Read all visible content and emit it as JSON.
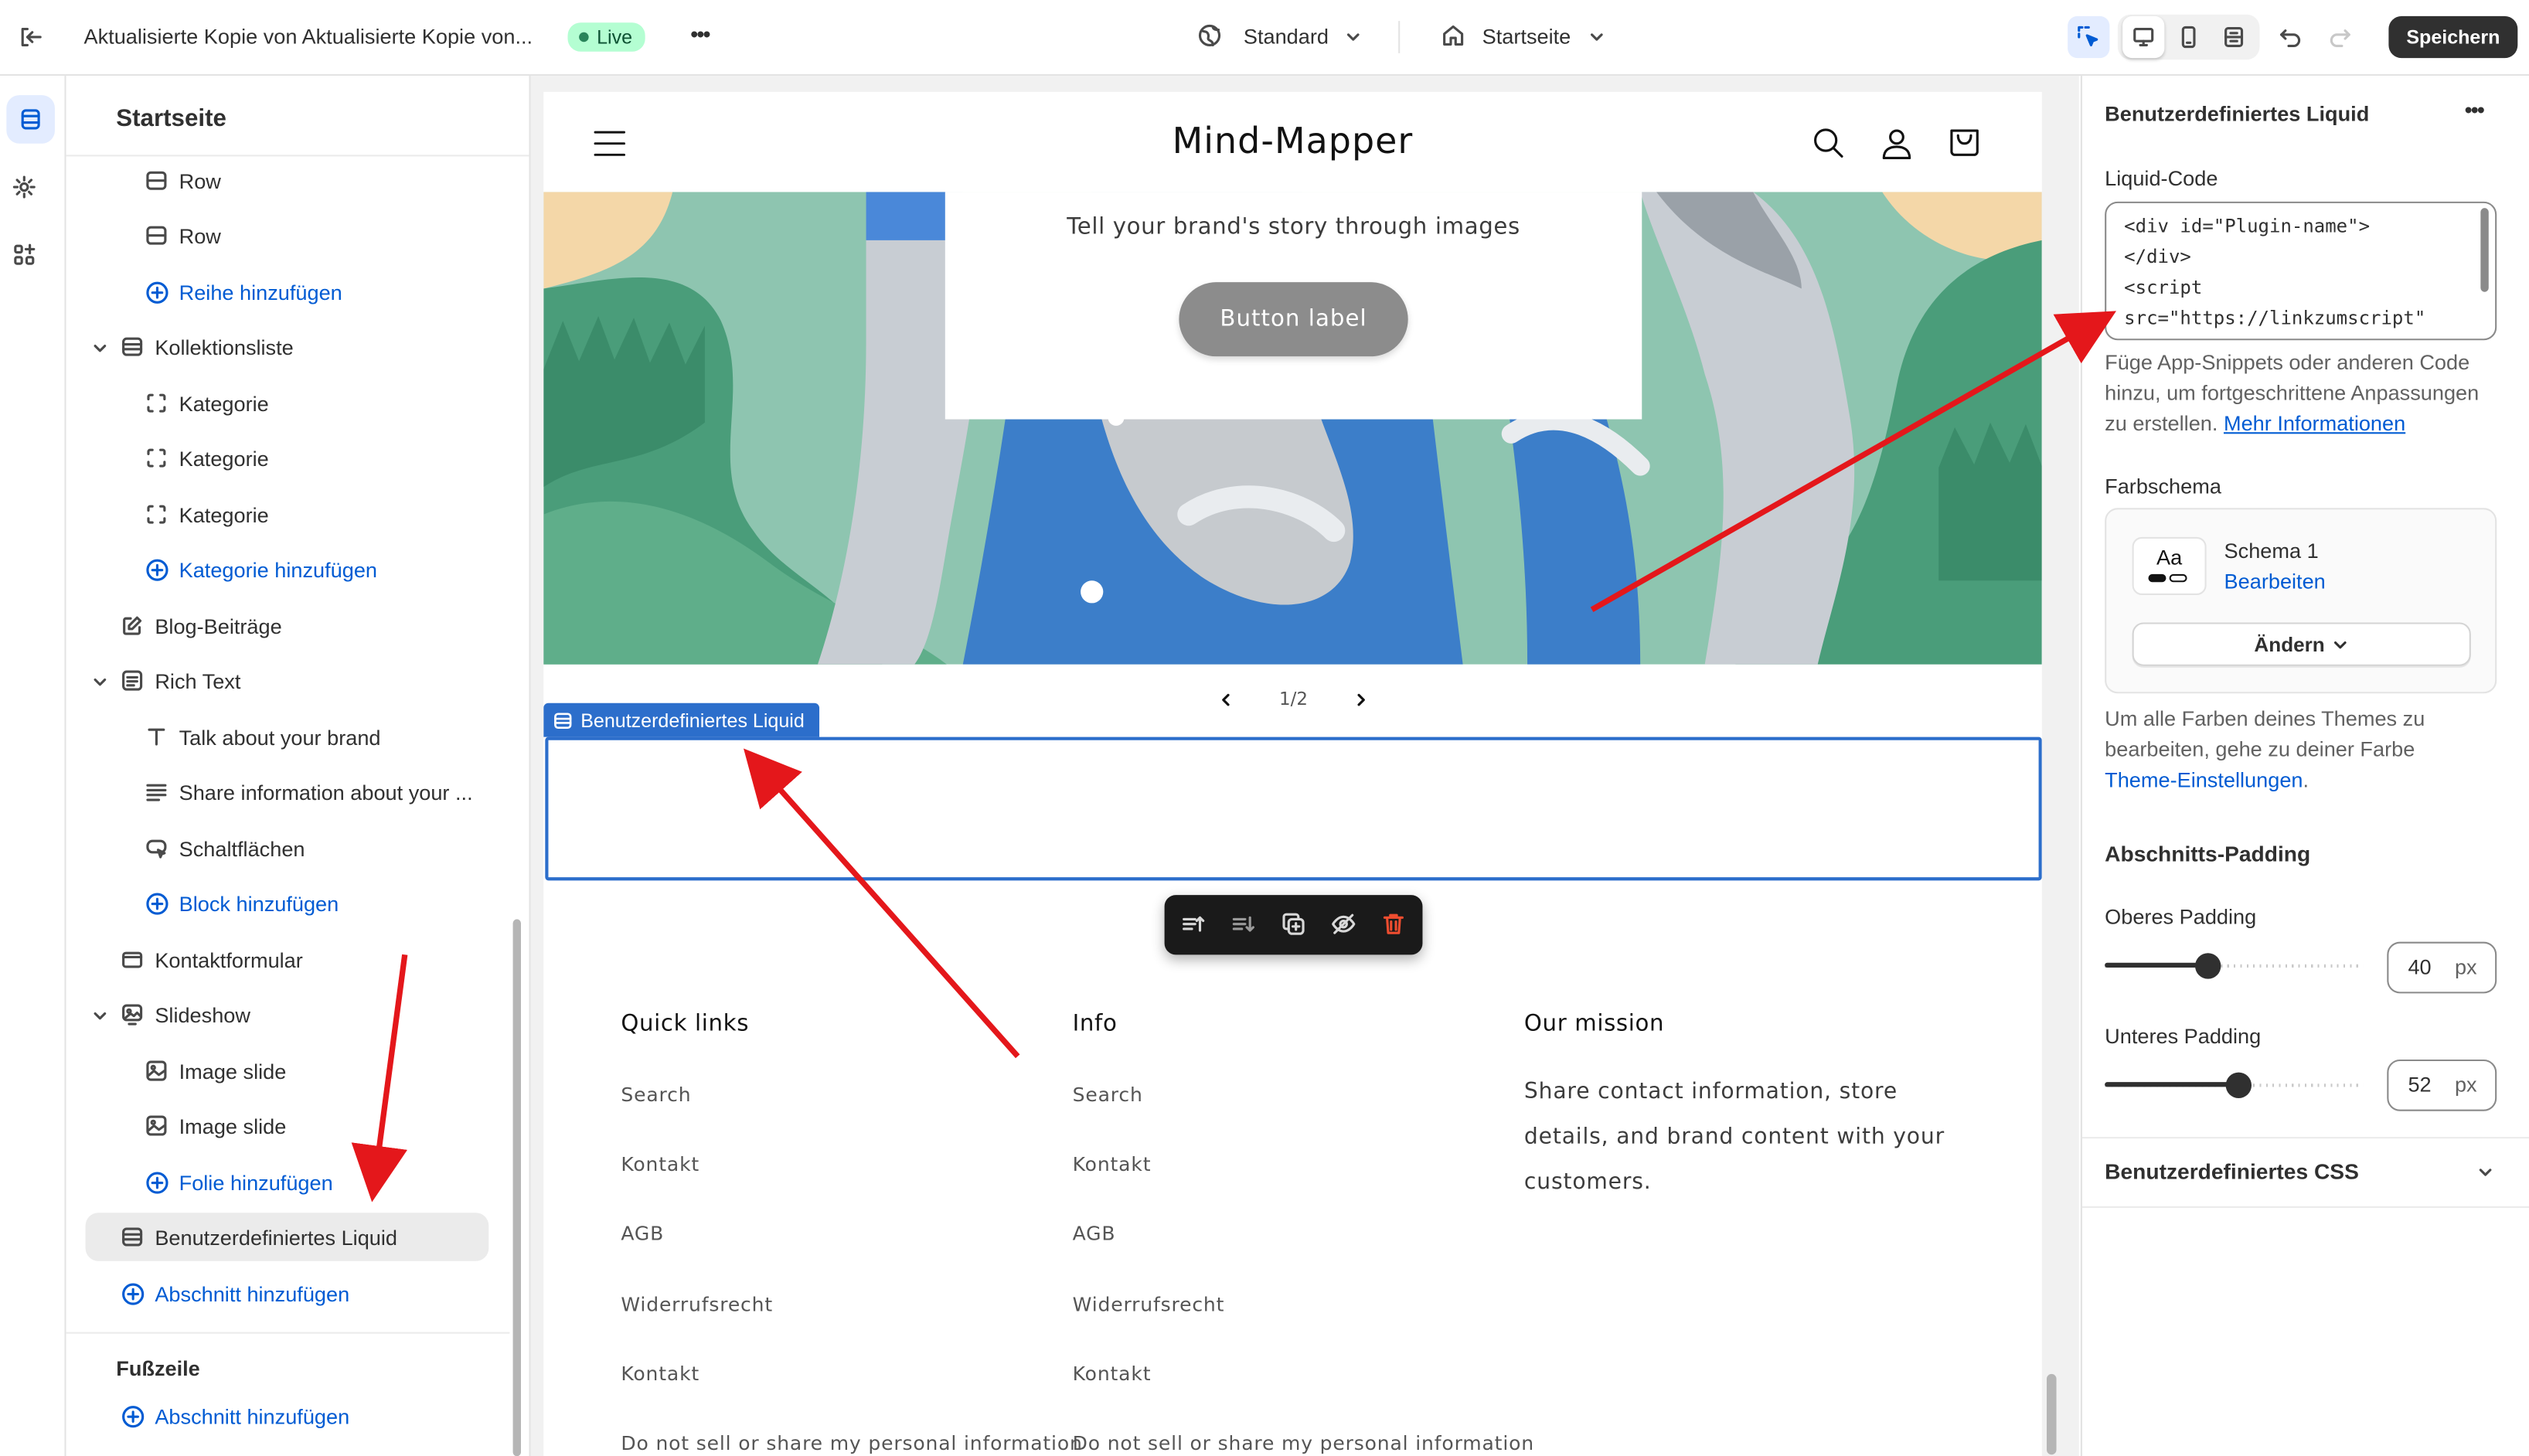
{
  "topbar": {
    "title": "Aktualisierte Kopie von Aktualisierte Kopie von...",
    "live_badge": "Live",
    "more": "•••",
    "theme_select": "Standard",
    "page_select": "Startseite",
    "save_label": "Speichern"
  },
  "sidebar": {
    "title": "Startseite",
    "items": [
      {
        "label": "Row"
      },
      {
        "label": "Row"
      },
      {
        "label": "Reihe hinzufügen"
      },
      {
        "label": "Kollektionsliste"
      },
      {
        "label": "Kategorie"
      },
      {
        "label": "Kategorie"
      },
      {
        "label": "Kategorie"
      },
      {
        "label": "Kategorie hinzufügen"
      },
      {
        "label": "Blog-Beiträge"
      },
      {
        "label": "Rich Text"
      },
      {
        "label": "Talk about your brand"
      },
      {
        "label": "Share information about your ..."
      },
      {
        "label": "Schaltflächen"
      },
      {
        "label": "Block hinzufügen"
      },
      {
        "label": "Kontaktformular"
      },
      {
        "label": "Slideshow"
      },
      {
        "label": "Image slide"
      },
      {
        "label": "Image slide"
      },
      {
        "label": "Folie hinzufügen"
      },
      {
        "label": "Benutzerdefiniertes Liquid"
      },
      {
        "label": "Abschnitt hinzufügen"
      }
    ],
    "footer_title": "Fußzeile",
    "footer_add": "Abschnitt hinzufügen"
  },
  "preview": {
    "store_name": "Mind-Mapper",
    "slide_text": "Tell your brand's story through images",
    "slide_button": "Button label",
    "pagination": "1/2",
    "section_tag": "Benutzerdefiniertes Liquid",
    "footer": {
      "col1_title": "Quick links",
      "col2_title": "Info",
      "col3_title": "Our mission",
      "col1_links": [
        "Search",
        "Kontakt",
        "AGB",
        "Widerrufsrecht",
        "Kontakt",
        "Do not sell or share my personal information"
      ],
      "col2_links": [
        "Search",
        "Kontakt",
        "AGB",
        "Widerrufsrecht",
        "Kontakt",
        "Do not sell or share my personal information"
      ],
      "mission_text": [
        "Share contact information, store",
        "details, and brand content with your",
        "customers."
      ]
    }
  },
  "panel": {
    "title": "Benutzerdefiniertes Liquid",
    "more": "•••",
    "code_label": "Liquid-Code",
    "code_lines": [
      "<div id=\"Plugin-name\">",
      "</div>",
      "<script",
      "src=\"https://linkzumscript\""
    ],
    "help_lines": [
      "Füge App-Snippets oder anderen Code",
      "hinzu, um fortgeschrittene Anpassungen"
    ],
    "help_line3": "zu erstellen.",
    "help_link": "Mehr Informationen",
    "color_scheme_label": "Farbschema",
    "scheme_sample": "Aa",
    "scheme_name": "Schema 1",
    "scheme_edit": "Bearbeiten",
    "change_label": "Ändern",
    "colors_hint_lines": [
      "Um alle Farben deines Themes zu",
      "bearbeiten, gehe zu deiner Farbe"
    ],
    "colors_hint_link": "Theme-Einstellungen",
    "colors_hint_end": ".",
    "padding_title": "Abschnitts-Padding",
    "top_padding_label": "Oberes Padding",
    "top_padding_value": "40",
    "bottom_padding_label": "Unteres Padding",
    "bottom_padding_value": "52",
    "unit": "px",
    "top_padding_fraction": 0.4,
    "bottom_padding_fraction": 0.52,
    "css_label": "Benutzerdefiniertes CSS"
  },
  "colors": {
    "accent": "#005bd3",
    "selection": "#2c6ecb",
    "annotation_arrow": "#e4171b",
    "live_badge": "#b4fed2"
  }
}
